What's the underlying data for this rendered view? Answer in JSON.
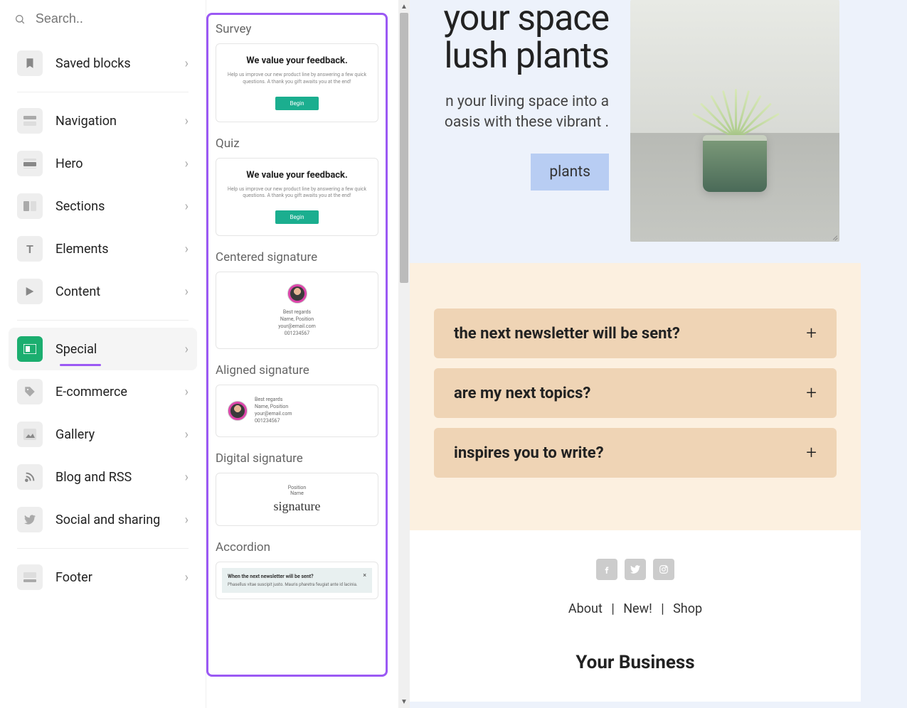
{
  "search": {
    "placeholder": "Search.."
  },
  "categories": {
    "saved": "Saved blocks",
    "navigation": "Navigation",
    "hero": "Hero",
    "sections": "Sections",
    "elements": "Elements",
    "content": "Content",
    "special": "Special",
    "ecommerce": "E-commerce",
    "gallery": "Gallery",
    "blog": "Blog and RSS",
    "social": "Social and sharing",
    "footer": "Footer"
  },
  "blocks": {
    "survey": {
      "title": "Survey",
      "heading": "We value your feedback.",
      "sub": "Help us improve our new product line by answering a few quick questions. A thank you gift awaits you at the end!",
      "button": "Begin"
    },
    "quiz": {
      "title": "Quiz",
      "heading": "We value your feedback.",
      "sub": "Help us improve our new product line by answering a few quick questions. A thank you gift awaits you at the end!",
      "button": "Begin"
    },
    "centered_sig": {
      "title": "Centered signature",
      "greeting": "Best regards",
      "name": "Name, Position",
      "email": "your@email.com",
      "phone": "001234567"
    },
    "aligned_sig": {
      "title": "Aligned signature",
      "greeting": "Best regards",
      "name": "Name, Position",
      "email": "your@email.com",
      "phone": "001234567"
    },
    "digital_sig": {
      "title": "Digital signature",
      "position": "Position",
      "name": "Name",
      "script": "signature"
    },
    "accordion": {
      "title": "Accordion",
      "q": "When the next newsletter will be sent?",
      "body": "Phasellus vitae suscipit justo. Mauris pharetra feugiat ante id lacinia."
    }
  },
  "hero": {
    "title_line1": "your space",
    "title_line2": "lush plants",
    "desc": "n your living space into a oasis with these vibrant .",
    "button": "plants"
  },
  "faq": {
    "q1": "the next newsletter will be sent?",
    "q2": "are my next topics?",
    "q3": "inspires you to write?"
  },
  "footer": {
    "about": "About",
    "new": "New!",
    "shop": "Shop",
    "sep": "|",
    "business": "Your Business"
  }
}
